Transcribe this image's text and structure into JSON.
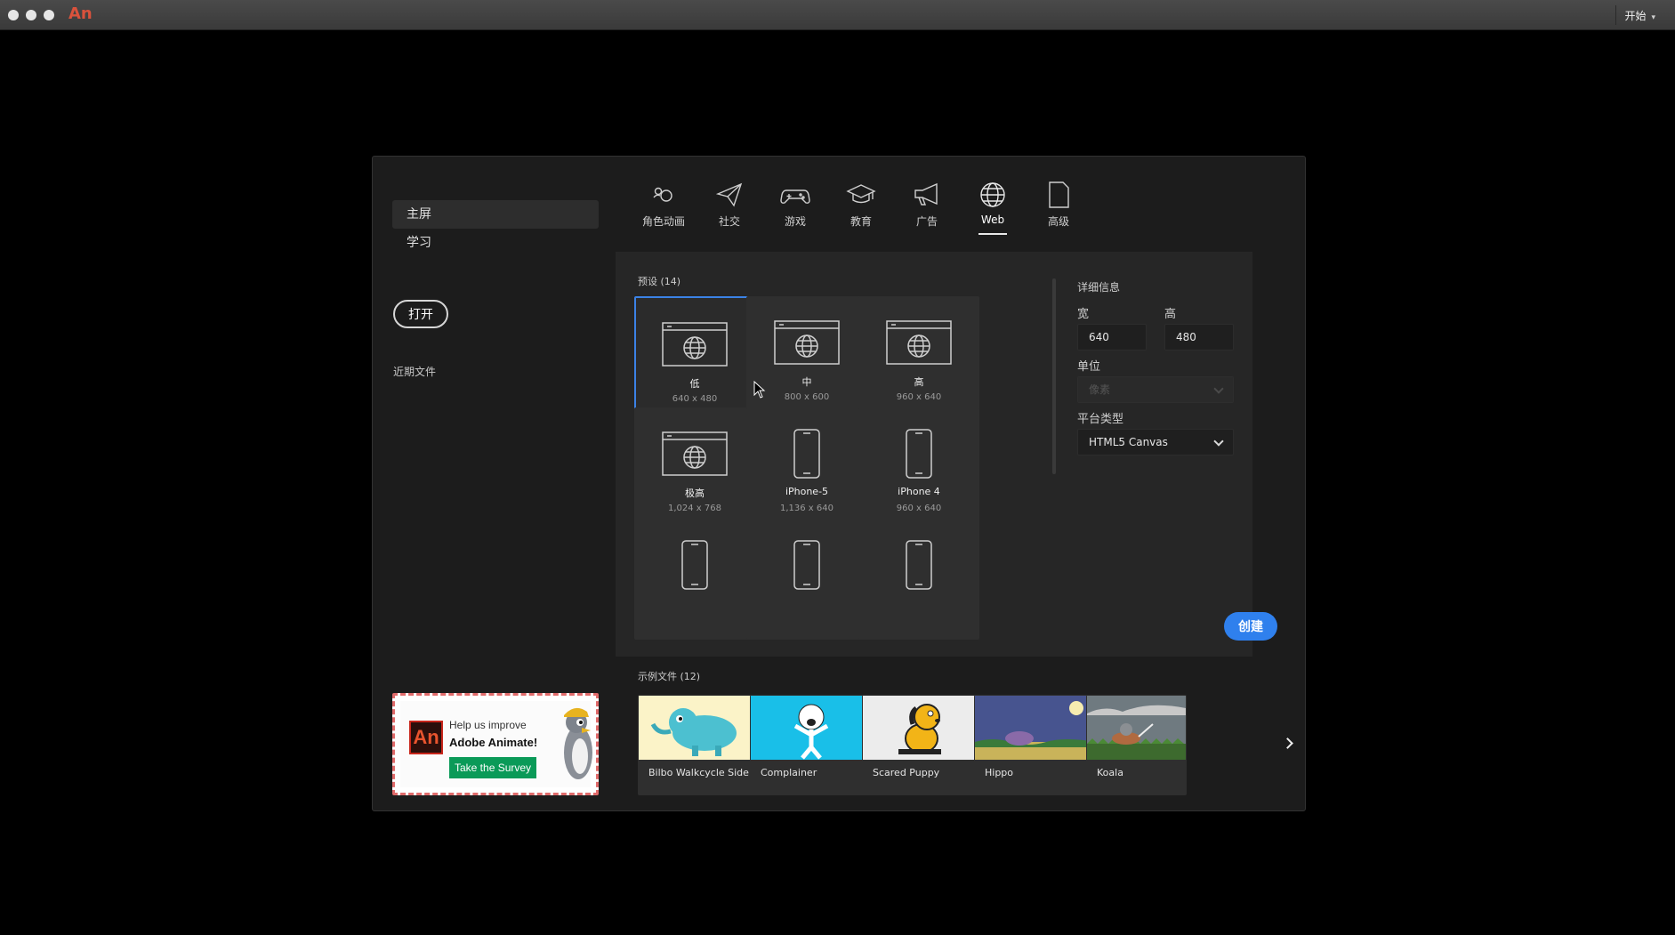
{
  "titlebar": {
    "app_logo": "An",
    "workspace": "开始"
  },
  "dialog": {
    "nav": {
      "items": [
        {
          "label": "主屏",
          "active": true
        },
        {
          "label": "学习",
          "active": false
        }
      ],
      "open_button": "打开",
      "recent_label": "近期文件"
    },
    "categories": [
      {
        "label": "角色动画",
        "icon": "character-animation-icon",
        "active": false
      },
      {
        "label": "社交",
        "icon": "paper-plane-icon",
        "active": false
      },
      {
        "label": "游戏",
        "icon": "gamepad-icon",
        "active": false
      },
      {
        "label": "教育",
        "icon": "graduation-cap-icon",
        "active": false
      },
      {
        "label": "广告",
        "icon": "megaphone-icon",
        "active": false
      },
      {
        "label": "Web",
        "icon": "globe-icon",
        "active": true
      },
      {
        "label": "高级",
        "icon": "document-icon",
        "active": false
      }
    ],
    "presets": {
      "title": "预设 (14)",
      "items": [
        {
          "name": "低",
          "size": "640 x 480",
          "icon": "web-icon",
          "selected": true
        },
        {
          "name": "中",
          "size": "800 x 600",
          "icon": "web-icon",
          "selected": false
        },
        {
          "name": "高",
          "size": "960 x 640",
          "icon": "web-icon",
          "selected": false
        },
        {
          "name": "极高",
          "size": "1,024 x 768",
          "icon": "web-icon",
          "selected": false
        },
        {
          "name": "iPhone-5",
          "size": "1,136 x 640",
          "icon": "phone-icon",
          "selected": false
        },
        {
          "name": "iPhone 4",
          "size": "960 x 640",
          "icon": "phone-icon",
          "selected": false
        },
        {
          "name": "",
          "size": "",
          "icon": "phone-icon",
          "selected": false
        },
        {
          "name": "",
          "size": "",
          "icon": "phone-icon",
          "selected": false
        },
        {
          "name": "",
          "size": "",
          "icon": "phone-icon",
          "selected": false
        }
      ]
    },
    "details": {
      "title": "详细信息",
      "width_label": "宽",
      "width_value": "640",
      "height_label": "高",
      "height_value": "480",
      "unit_label": "单位",
      "unit_value": "像素",
      "platform_label": "平台类型",
      "platform_value": "HTML5 Canvas",
      "create_button": "创建"
    },
    "samples": {
      "title": "示例文件 (12)",
      "items": [
        {
          "name": "Bilbo Walkcycle Side",
          "bg": "#fbf3c8"
        },
        {
          "name": "Complainer",
          "bg": "#19bfe8"
        },
        {
          "name": "Scared Puppy",
          "bg": "#ececec"
        },
        {
          "name": "Hippo",
          "bg": "#3e4a8a"
        },
        {
          "name": "Koala",
          "bg": "#7f8a8f"
        }
      ]
    },
    "survey": {
      "logo": "An",
      "line1": "Help us improve",
      "line2": "Adobe Animate!",
      "button": "Take the Survey"
    }
  },
  "colors": {
    "accent": "#2f80ed",
    "selected_border": "#3b82e6",
    "survey_button": "#0a9a58"
  }
}
